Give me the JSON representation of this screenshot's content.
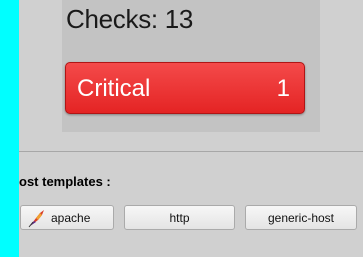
{
  "checks": {
    "title": "Checks: 13",
    "critical": {
      "label": "Critical",
      "count": "1"
    }
  },
  "host_templates": {
    "label": "ost templates :",
    "buttons": [
      {
        "label": "apache",
        "icon": "apache-feather-icon"
      },
      {
        "label": "http"
      },
      {
        "label": "generic-host"
      }
    ]
  },
  "colors": {
    "critical": "#e42424",
    "background": "#d0d0d0",
    "edge": "#00ffff"
  }
}
